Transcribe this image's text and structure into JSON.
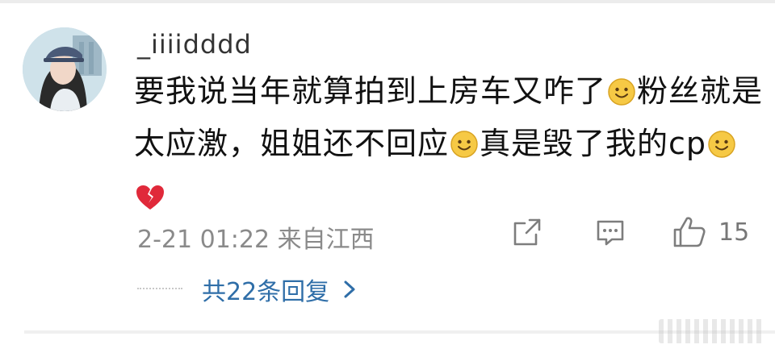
{
  "user": {
    "name": "_iiiidddd"
  },
  "comment": {
    "part1": "要我说当年就算拍到上房车又咋了",
    "part2": "粉丝就是太应激，姐姐还不回应",
    "part3": "真是毁了我的cp",
    "emoji_smile": "smile-emoji",
    "emoji_heart": "broken-heart-emoji"
  },
  "meta": {
    "timestamp": "2-21 01:22 来自江西"
  },
  "actions": {
    "share_icon": "share-icon",
    "reply_icon": "comment-icon",
    "like_icon": "like-icon",
    "like_count": "15"
  },
  "replies": {
    "label": "共22条回复"
  },
  "colors": {
    "link": "#2f6ea8",
    "meta": "#8a8a8a",
    "text": "#111111"
  }
}
